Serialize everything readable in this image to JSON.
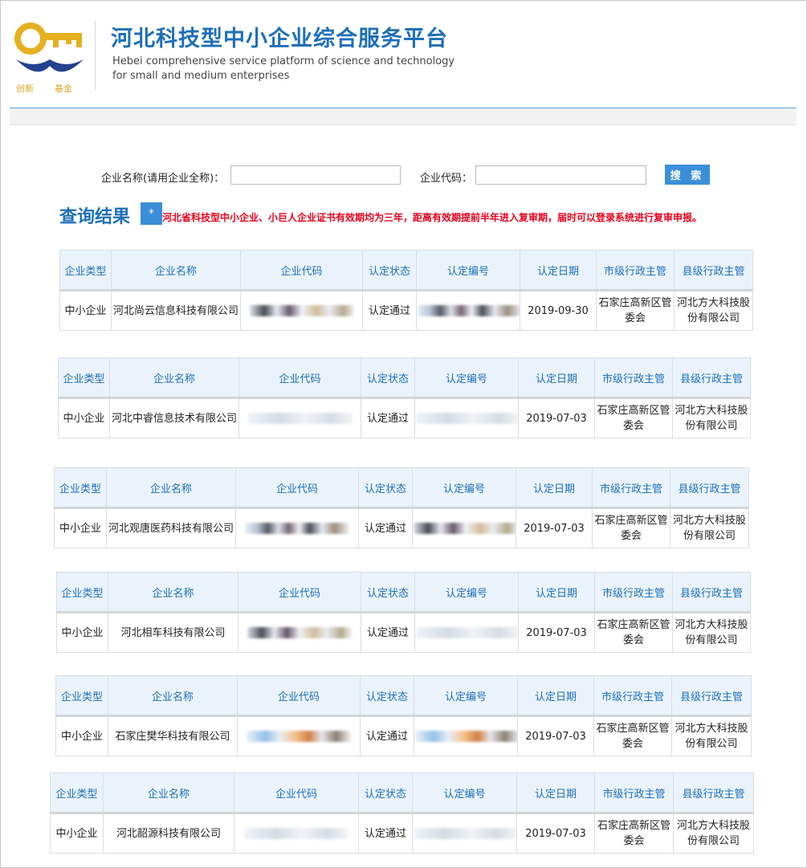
{
  "header": {
    "logo_text_left": "创新",
    "logo_text_right": "基金",
    "title_cn": "河北科技型中小企业综合服务平台",
    "title_en_line1": "Hebei  comprehensive service platform of science and technology",
    "title_en_line2": "for small and medium enterprises"
  },
  "search": {
    "name_label": "企业名称(请用企业全称)：",
    "name_value": "",
    "code_label": "企业代码：",
    "code_value": "",
    "button_label": "搜 索"
  },
  "results": {
    "title": "查询结果",
    "star": "*",
    "notice": "河北省科技型中小企业、小巨人企业证书有效期均为三年，距离有效期提前半年进入复审期，届时可以登录系统进行复审申报。"
  },
  "columns": [
    "企业类型",
    "企业名称",
    "企业代码",
    "认定状态",
    "认定编号",
    "认定日期",
    "市级行政主管",
    "县级行政主管"
  ],
  "records": [
    {
      "type": "中小企业",
      "name": "河北尚云信息科技有限公司",
      "code": "",
      "status": "认定通过",
      "cert_no": "",
      "date": "2019-09-30",
      "city_admin": "石家庄高新区管委会",
      "county_admin": "河北方大科技股份有限公司"
    },
    {
      "type": "中小企业",
      "name": "河北中睿信息技术有限公司",
      "code": "",
      "status": "认定通过",
      "cert_no": "",
      "date": "2019-07-03",
      "city_admin": "石家庄高新区管委会",
      "county_admin": "河北方大科技股份有限公司"
    },
    {
      "type": "中小企业",
      "name": "河北观唐医药科技有限公司",
      "code": "",
      "status": "认定通过",
      "cert_no": "",
      "date": "2019-07-03",
      "city_admin": "石家庄高新区管委会",
      "county_admin": "河北方大科技股份有限公司"
    },
    {
      "type": "中小企业",
      "name": "河北相车科技有限公司",
      "code": "",
      "status": "认定通过",
      "cert_no": "",
      "date": "2019-07-03",
      "city_admin": "石家庄高新区管委会",
      "county_admin": "河北方大科技股份有限公司"
    },
    {
      "type": "中小企业",
      "name": "石家庄樊华科技有限公司",
      "code": "",
      "status": "认定通过",
      "cert_no": "",
      "date": "2019-07-03",
      "city_admin": "石家庄高新区管委会",
      "county_admin": "河北方大科技股份有限公司"
    },
    {
      "type": "中小企业",
      "name": "河北韶源科技有限公司",
      "code": "",
      "status": "认定通过",
      "cert_no": "",
      "date": "2019-07-03",
      "city_admin": "石家庄高新区管委会",
      "county_admin": "河北方大科技股份有限公司"
    }
  ]
}
